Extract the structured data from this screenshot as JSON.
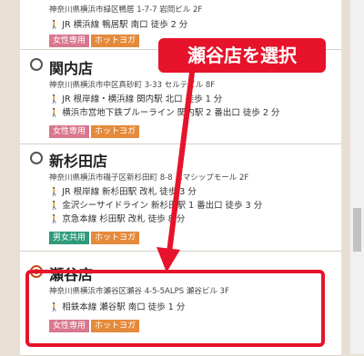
{
  "annotation": {
    "callout": "瀬谷店を選択",
    "color": "#e6132a"
  },
  "stores": [
    {
      "name": "",
      "selected": false,
      "address": "神奈川県横浜市緑区鴨居 1-7-7 岩岡ビル 2F",
      "routes": [
        "JR 横浜線 鴨居駅 南口 徒歩 2 分"
      ],
      "tags": [
        "女性専用",
        "ホットヨガ"
      ]
    },
    {
      "name": "関内店",
      "selected": false,
      "address": "神奈川県横浜市中区真砂町 3-33 セルテビル 8F",
      "routes": [
        "JR 根岸線・横浜線 関内駅 北口 徒歩 1 分",
        "横浜市営地下鉄ブルーライン 関内駅 2 番出口 徒歩 2 分"
      ],
      "tags": [
        "女性専用",
        "ホットヨガ"
      ]
    },
    {
      "name": "新杉田店",
      "selected": false,
      "address": "神奈川県横浜市磯子区新杉田町 8-8 ハマシップモール 2F",
      "routes": [
        "JR 根岸線 新杉田駅 改札 徒歩 3 分",
        "金沢シーサイドライン 新杉田駅 1 番出口 徒歩 3 分",
        "京急本線 杉田駅 改札 徒歩 8 分"
      ],
      "tags": [
        "男女共用",
        "ホットヨガ"
      ]
    },
    {
      "name": "瀬谷店",
      "selected": true,
      "address": "神奈川県横浜市瀬谷区瀬谷 4-5-5ALPS 瀬谷ビル 3F",
      "routes": [
        "相鉄本線 瀬谷駅 南口 徒歩 1 分"
      ],
      "tags": [
        "女性専用",
        "ホットヨガ"
      ]
    }
  ],
  "icons": {
    "walk": "walking-person-icon",
    "radio": "radio-button-icon"
  }
}
